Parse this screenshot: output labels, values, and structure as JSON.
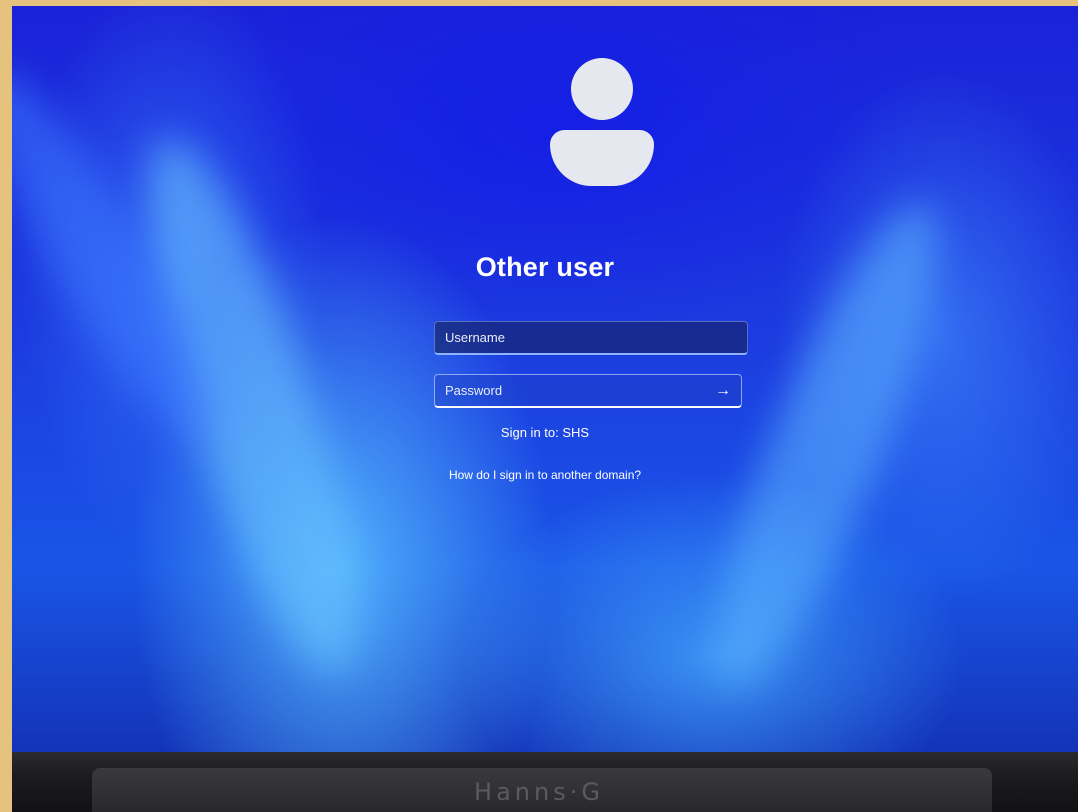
{
  "login": {
    "title": "Other user",
    "username_placeholder": "Username",
    "password_placeholder": "Password",
    "submit_icon": "→",
    "sign_in_to": "Sign in to: SHS",
    "help_link": "How do I sign in to another domain?"
  },
  "monitor": {
    "brand": "Hanns·G"
  },
  "colors": {
    "wallpaper_primary": "#1a22d8",
    "wallpaper_highlight": "#5abeff",
    "avatar": "#e6e8f0",
    "text": "#ffffff"
  },
  "icons": {
    "avatar": "user-avatar-icon",
    "submit": "arrow-right-icon"
  }
}
